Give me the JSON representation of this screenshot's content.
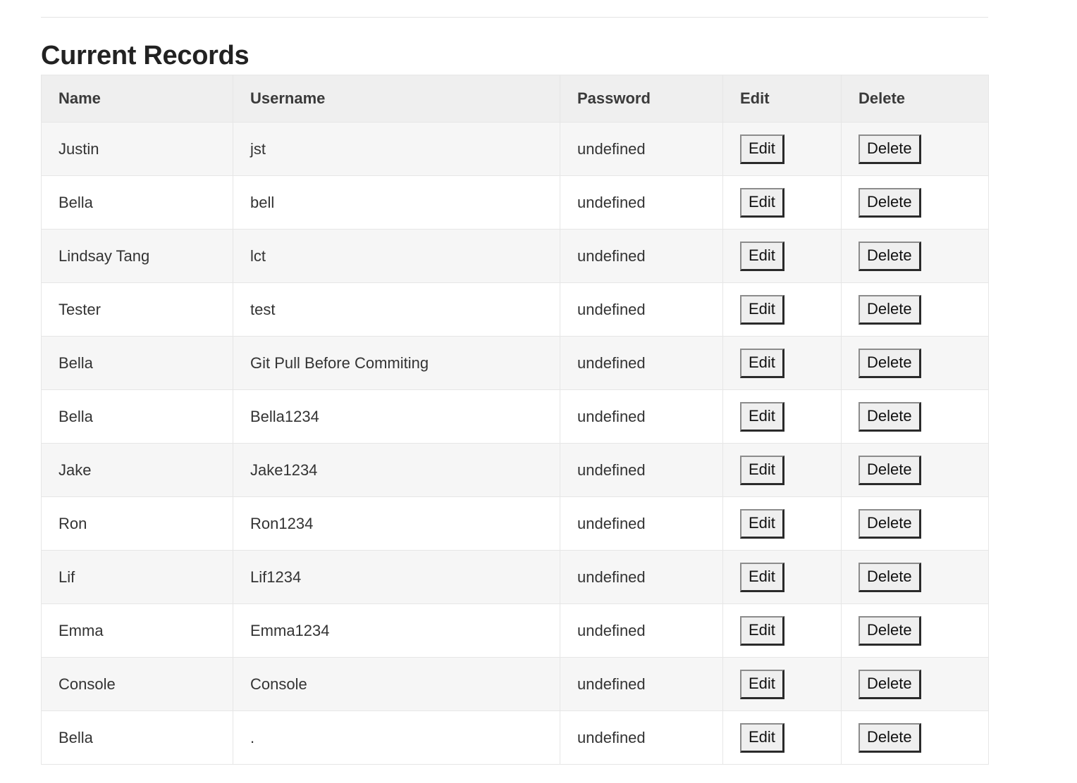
{
  "section": {
    "title": "Current Records"
  },
  "table": {
    "headers": {
      "name": "Name",
      "username": "Username",
      "password": "Password",
      "edit": "Edit",
      "delete": "Delete"
    },
    "edit_label": "Edit",
    "delete_label": "Delete",
    "rows": [
      {
        "name": "Justin",
        "username": "jst",
        "password": "undefined"
      },
      {
        "name": "Bella",
        "username": "bell",
        "password": "undefined"
      },
      {
        "name": "Lindsay Tang",
        "username": "lct",
        "password": "undefined"
      },
      {
        "name": "Tester",
        "username": "test",
        "password": "undefined"
      },
      {
        "name": "Bella",
        "username": "Git Pull Before Commiting",
        "password": "undefined"
      },
      {
        "name": "Bella",
        "username": "Bella1234",
        "password": "undefined"
      },
      {
        "name": "Jake",
        "username": "Jake1234",
        "password": "undefined"
      },
      {
        "name": "Ron",
        "username": "Ron1234",
        "password": "undefined"
      },
      {
        "name": "Lif",
        "username": "Lif1234",
        "password": "undefined"
      },
      {
        "name": "Emma",
        "username": "Emma1234",
        "password": "undefined"
      },
      {
        "name": "Console",
        "username": "Console",
        "password": "undefined"
      },
      {
        "name": "Bella",
        "username": ".",
        "password": "undefined"
      }
    ]
  }
}
